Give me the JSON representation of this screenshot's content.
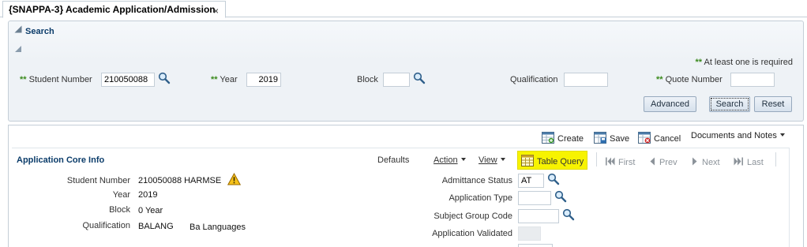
{
  "tab": {
    "title": "{SNAPPA-3} Academic Application/Admission",
    "close_glyph": "×"
  },
  "search": {
    "title": "Search",
    "required_marker": "**",
    "required_note": "At least one is required",
    "fields": {
      "student_number": {
        "label": "Student Number",
        "value": "210050088"
      },
      "year": {
        "label": "Year",
        "value": "2019"
      },
      "block": {
        "label": "Block",
        "value": ""
      },
      "qualification": {
        "label": "Qualification",
        "value": ""
      },
      "quote_number": {
        "label": "Quote Number",
        "value": ""
      }
    },
    "buttons": {
      "advanced": "Advanced",
      "search": "Search",
      "reset": "Reset"
    }
  },
  "toolbar": {
    "create": "Create",
    "save": "Save",
    "cancel": "Cancel",
    "documents": "Documents and Notes"
  },
  "core": {
    "title": "Application Core Info",
    "defaults": "Defaults",
    "action": "Action",
    "view": "View",
    "table_query": "Table Query",
    "first": "First",
    "prev": "Prev",
    "next": "Next",
    "last": "Last",
    "left": {
      "student_number": {
        "label": "Student Number",
        "value": "210050088  HARMSE"
      },
      "year": {
        "label": "Year",
        "value": "2019"
      },
      "block": {
        "label": "Block",
        "value": "0  Year"
      },
      "qualification": {
        "label": "Qualification",
        "code": "BALANG",
        "desc": "Ba Languages"
      }
    },
    "right": {
      "admittance_status": {
        "label": "Admittance Status",
        "value": "AT"
      },
      "application_type": {
        "label": "Application Type",
        "value": ""
      },
      "subject_group_code": {
        "label": "Subject Group Code",
        "value": ""
      },
      "application_validated": {
        "label": "Application Validated",
        "value": ""
      }
    }
  },
  "colors": {
    "accent_title": "#0b3c6a",
    "required_green": "#3b8a1d",
    "highlight": "#f7f300"
  }
}
